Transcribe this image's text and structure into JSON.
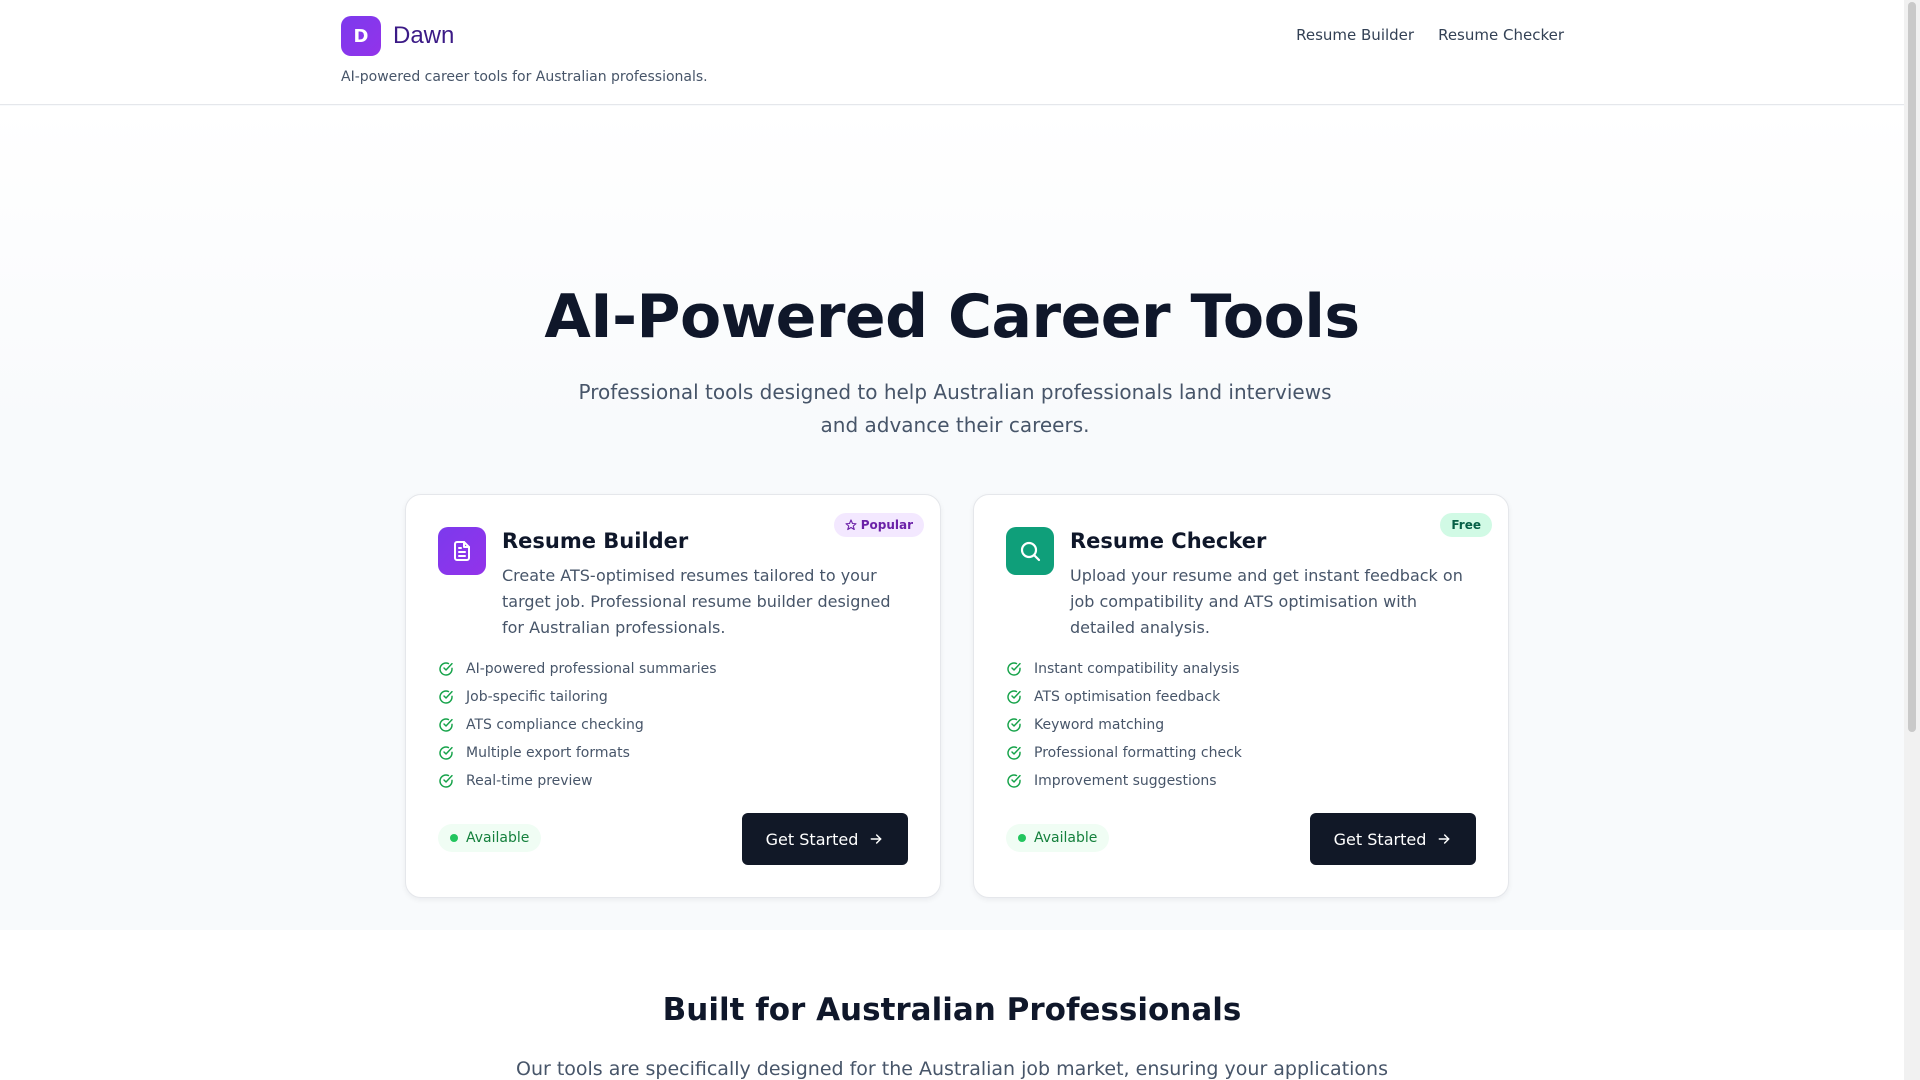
{
  "header": {
    "brand_initial": "D",
    "brand_name": "Dawn",
    "tagline": "AI-powered career tools for Australian professionals.",
    "nav": [
      {
        "label": "Resume Builder"
      },
      {
        "label": "Resume Checker"
      }
    ]
  },
  "hero": {
    "title": "AI-Powered Career Tools",
    "subtitle": "Professional tools designed to help Australian professionals land interviews and advance their careers."
  },
  "cards": [
    {
      "title": "Resume Builder",
      "icon": "document-icon",
      "badge": "Popular",
      "badge_icon": "star-icon",
      "description": "Create ATS-optimised resumes tailored to your target job. Professional resume builder designed for Australian professionals.",
      "features": [
        "AI-powered professional summaries",
        "Job-specific tailoring",
        "ATS compliance checking",
        "Multiple export formats",
        "Real-time preview"
      ],
      "status": "Available",
      "cta": "Get Started"
    },
    {
      "title": "Resume Checker",
      "icon": "search-icon",
      "badge": "Free",
      "description": "Upload your resume and get instant feedback on job compatibility and ATS optimisation with detailed analysis.",
      "features": [
        "Instant compatibility analysis",
        "ATS optimisation feedback",
        "Keyword matching",
        "Professional formatting check",
        "Improvement suggestions"
      ],
      "status": "Available",
      "cta": "Get Started"
    }
  ],
  "section": {
    "title": "Built for Australian Professionals",
    "text": "Our tools are specifically designed for the Australian job market, ensuring your applications"
  },
  "colors": {
    "brand": "#7c3aed",
    "checker_accent": "#0f9f7a",
    "check_green": "#16a34a",
    "cta_dark": "#111827"
  }
}
